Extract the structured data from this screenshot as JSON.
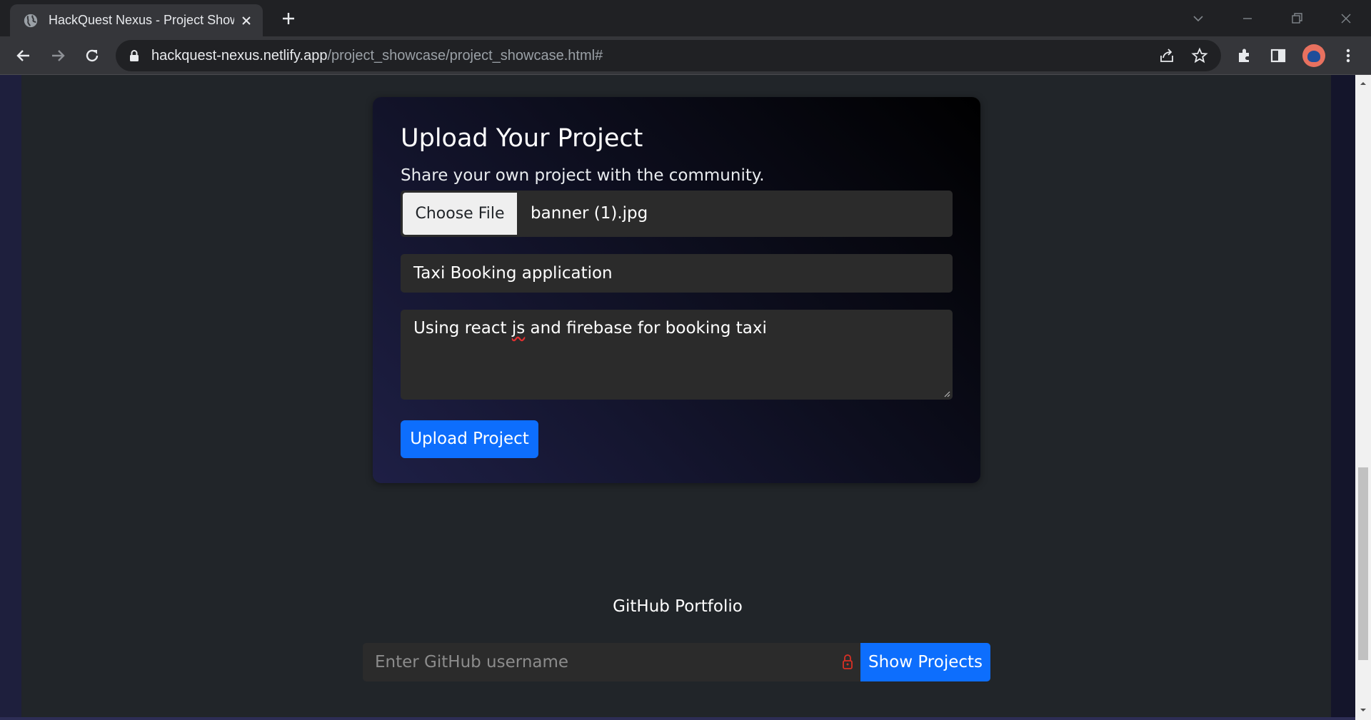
{
  "browser": {
    "tab_title": "HackQuest Nexus - Project Show",
    "url_host": "hackquest-nexus.netlify.app",
    "url_path": "/project_showcase/project_showcase.html#",
    "icons": [
      "globe-icon",
      "close-icon",
      "plus-icon",
      "back-icon",
      "forward-icon",
      "reload-icon",
      "lock-icon",
      "share-icon",
      "star-icon",
      "extensions-icon",
      "side-panel-icon",
      "profile-avatar",
      "menu-icon"
    ]
  },
  "upload": {
    "title": "Upload Your Project",
    "subtitle": "Share your own project with the community.",
    "file_button": "Choose File",
    "file_name": "banner (1).jpg",
    "project_name": "Taxi Booking application",
    "description_before": "Using react ",
    "description_misspelled": "js",
    "description_after": " and firebase for booking taxi",
    "submit_label": "Upload Project"
  },
  "github": {
    "title": "GitHub Portfolio",
    "placeholder": "Enter GitHub username",
    "button_label": "Show Projects"
  },
  "colors": {
    "accent": "#0d6efd",
    "page_bg": "#212529",
    "input_bg": "#2b2b2b"
  }
}
